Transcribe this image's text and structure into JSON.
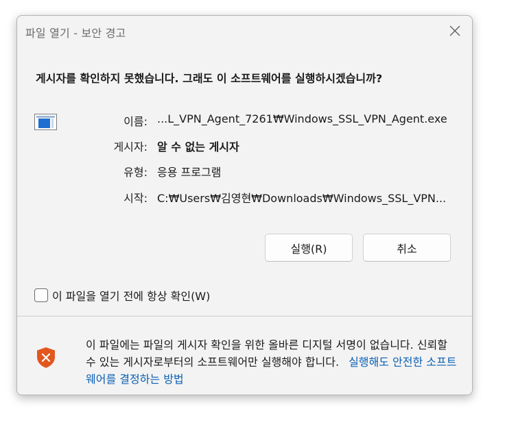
{
  "window": {
    "title": "파일 열기 - 보안 경고"
  },
  "question": "게시자를 확인하지 못했습니다.  그래도 이 소프트웨어를 실행하시겠습니까?",
  "file_info": [
    {
      "label": "이름:",
      "value": "...L_VPN_Agent_7261₩Windows_SSL_VPN_Agent.exe",
      "bold": false
    },
    {
      "label": "게시자:",
      "value": "알 수 없는 게시자",
      "bold": true
    },
    {
      "label": "유형:",
      "value": "응용 프로그램",
      "bold": false
    },
    {
      "label": "시작:",
      "value": "C:₩Users₩김영현₩Downloads₩Windows_SSL_VPN...",
      "bold": false
    }
  ],
  "buttons": {
    "run": "실행(R)",
    "cancel": "취소"
  },
  "checkbox": {
    "label": "이 파일을 열기 전에 항상 확인(W)",
    "checked": false
  },
  "warning": {
    "text": "이 파일에는 파일의 게시자 확인을 위한 올바른 디지털 서명이 없습니다.  신뢰할 수 있는 게시자로부터의 소프트웨어만 실행해야 합니다.",
    "link": "실행해도 안전한 소프트웨어를 결정하는 방법"
  },
  "icons": {
    "file": "executable-file-icon",
    "shield": "security-shield-icon",
    "close": "close-icon"
  },
  "colors": {
    "shield": "#e2571e",
    "link": "#0a5fb4",
    "file_icon": "#1f6fd0"
  }
}
